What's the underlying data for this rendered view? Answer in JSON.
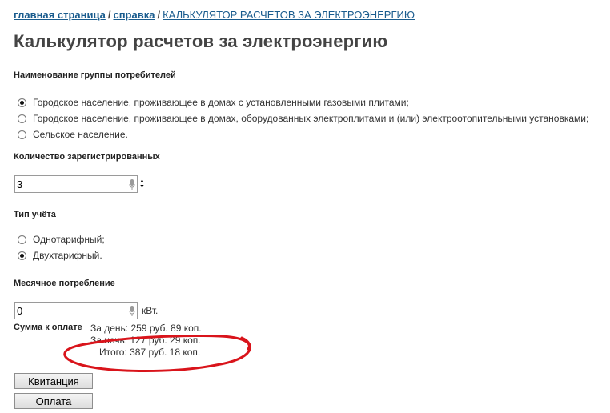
{
  "breadcrumb": {
    "items": [
      "главная страница",
      "справка"
    ],
    "current": "КАЛЬКУЛЯТОР РАСЧЕТОВ ЗА ЭЛЕКТРОЭНЕРГИЮ",
    "separator": "/"
  },
  "page_title": "Калькулятор расчетов за электроэнергию",
  "consumer_group": {
    "label": "Наименование группы потребителей",
    "options": [
      "Городское население, проживающее в домах с установленными газовыми плитами;",
      "Городское население, проживающее в домах, оборудованных электроплитами и (или) электроотопительными установками;",
      "Сельское население."
    ],
    "selected_index": 0
  },
  "registered": {
    "label": "Количество зарегистрированных",
    "value": "3"
  },
  "tariff": {
    "label": "Тип учёта",
    "options": [
      "Однотарифный;",
      "Двухтарифный."
    ],
    "selected_index": 1
  },
  "consumption": {
    "label": "Месячное потребление",
    "value": "0",
    "unit": "кВт."
  },
  "sum": {
    "label": "Сумма к оплате",
    "day": "За день: 259 руб. 89 коп.",
    "night": "За ночь: 127 руб. 29 коп.",
    "total": "Итого: 387 руб. 18 коп."
  },
  "buttons": {
    "receipt": "Квитанция",
    "payment": "Оплата"
  },
  "colors": {
    "link": "#1a5c8e",
    "annotation": "#d9141b"
  }
}
